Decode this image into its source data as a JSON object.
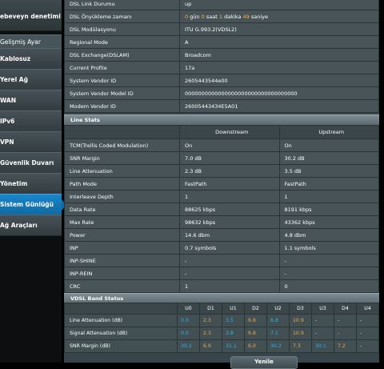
{
  "sidebar": {
    "parental_label": "ebeveyn denetimi",
    "advanced_header": "Gelişmiş Ayar",
    "items": [
      {
        "label": "Kablosuz"
      },
      {
        "label": "Yerel Ağ"
      },
      {
        "label": "WAN"
      },
      {
        "label": "IPv6"
      },
      {
        "label": "VPN"
      },
      {
        "label": "Güvenlik Duvarı"
      },
      {
        "label": "Yönetim"
      },
      {
        "label": "Sistem Günlüğü"
      },
      {
        "label": "Ağ Araçları"
      }
    ],
    "active_index": 7
  },
  "dsl_info": [
    {
      "key": "DSL Link Durumu",
      "value": "up"
    },
    {
      "key": "DSL Önyükleme zamanı",
      "uptime": {
        "d_val": "0",
        "d_unit": "gün",
        "h_val": "0",
        "h_unit": "saat",
        "m_val": "1",
        "m_unit": "dakika",
        "s_val": "49",
        "s_unit": "saniye"
      }
    },
    {
      "key": "DSL Modülasyonu",
      "value": "ITU G.993.2(VDSL2)"
    },
    {
      "key": "Regional Mode",
      "value": "A"
    },
    {
      "key": "DSL Exchange(DSLAM)",
      "value": "Broadcom"
    },
    {
      "key": "Current Profile",
      "value": "17a"
    },
    {
      "key": "System Vendor ID",
      "value": "2605443544e00"
    },
    {
      "key": "System Vendor Model ID",
      "value": "0000000000000000000000000000000000"
    },
    {
      "key": "Modem Vendor ID",
      "value": "26005443434E5A01"
    }
  ],
  "line_stats": {
    "title": "Line Stats",
    "col_downstream": "Downstream",
    "col_upstream": "Upstream",
    "rows": [
      {
        "key": "TCM(Trellis Coded Modulation)",
        "down": "On",
        "up": "On"
      },
      {
        "key": "SNR Margin",
        "down": "7.0 dB",
        "up": "30.2 dB"
      },
      {
        "key": "Line Attenuation",
        "down": "2.3 dB",
        "up": "3.5 dB"
      },
      {
        "key": "Path Mode",
        "down": "FastPath",
        "up": "FastPath"
      },
      {
        "key": "Interleave Depth",
        "down": "1",
        "up": "1"
      },
      {
        "key": "Data Rate",
        "down": "88625 kbps",
        "up": "8191 kbps"
      },
      {
        "key": "Max Rate",
        "down": "98632 kbps",
        "up": "43362 kbps"
      },
      {
        "key": "Power",
        "down": "14.6 dbm",
        "up": "4.8 dbm"
      },
      {
        "key": "INP",
        "down": "0.7 symbols",
        "up": "1.1 symbols"
      },
      {
        "key": "INP-SHINE",
        "down": "-",
        "up": "-"
      },
      {
        "key": "INP-REIN",
        "down": "-",
        "up": "-"
      },
      {
        "key": "CRC",
        "down": "1",
        "up": "0"
      }
    ]
  },
  "band_status": {
    "title": "VDSL Band Status",
    "bands": [
      "U0",
      "D1",
      "U1",
      "D2",
      "U2",
      "D3",
      "U3",
      "D4",
      "U4"
    ],
    "colors": {
      "upstream": "#2fb0ea",
      "downstream": "#f0a44a",
      "empty": "#dddddd"
    },
    "rows": [
      {
        "key": "Line Attenuation (dB)",
        "values": [
          "0.0",
          "2.3",
          "3.5",
          "6.8",
          "6.8",
          "10.9",
          "-",
          "-",
          "-"
        ]
      },
      {
        "key": "Signal Attenuation (dB)",
        "values": [
          "0.0",
          "2.3",
          "3.8",
          "6.8",
          "7.1",
          "10.9",
          "-",
          "-",
          "-"
        ]
      },
      {
        "key": "SNR Margin (dB)",
        "values": [
          "30.2",
          "6.9",
          "31.1",
          "6.0",
          "30.2",
          "7.3",
          "30.1",
          "7.2",
          "-"
        ]
      }
    ]
  },
  "apply_label": "Yenile"
}
